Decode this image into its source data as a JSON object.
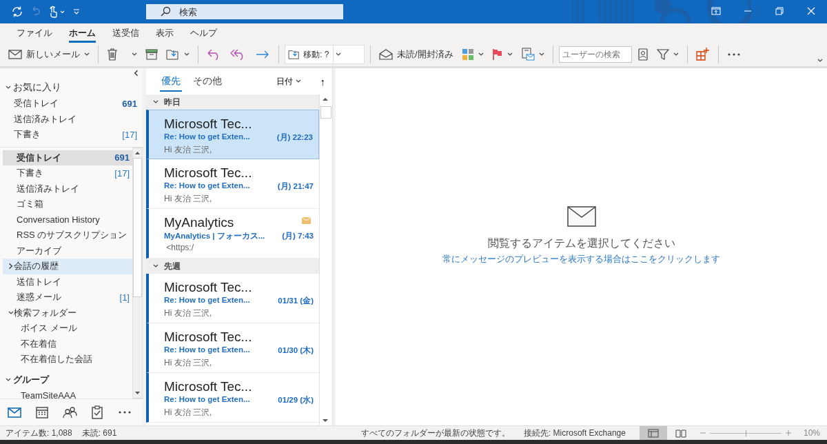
{
  "title_bar": {
    "search_placeholder": "検索"
  },
  "ribbon_tabs": [
    {
      "label": "ファイル",
      "selected": false
    },
    {
      "label": "ホーム",
      "selected": true
    },
    {
      "label": "送受信",
      "selected": false
    },
    {
      "label": "表示",
      "selected": false
    },
    {
      "label": "ヘルプ",
      "selected": false
    }
  ],
  "toolbar": {
    "new_mail": "新しいメール",
    "move_label": "移動: ?",
    "read_unread": "未読/開封済み",
    "people_search_placeholder": "ユーザーの検索"
  },
  "folder_pane": {
    "favorites": {
      "title": "お気に入り",
      "expanded": true,
      "items": [
        {
          "name": "受信トレイ",
          "count": "691",
          "kind": "unread"
        },
        {
          "name": "送信済みトレイ"
        },
        {
          "name": "下書き",
          "count": "[17]",
          "kind": "bracket"
        }
      ]
    },
    "mailbox": [
      {
        "name": "受信トレイ",
        "count": "691",
        "kind": "unread",
        "selected": true,
        "hovered": false
      },
      {
        "name": "下書き",
        "count": "[17]",
        "kind": "bracket",
        "selected": false,
        "hovered": false
      },
      {
        "name": "送信済みトレイ",
        "selected": false,
        "hovered": false
      },
      {
        "name": "ゴミ箱",
        "selected": false,
        "hovered": false
      },
      {
        "name": "Conversation History",
        "selected": false,
        "hovered": false
      },
      {
        "name": "RSS のサブスクリプション",
        "selected": false,
        "hovered": false
      },
      {
        "name": "アーカイブ",
        "selected": false,
        "hovered": false
      },
      {
        "name": "会話の履歴",
        "selected": false,
        "hovered": true,
        "expanded": false
      },
      {
        "name": "送信トレイ",
        "selected": false,
        "hovered": false
      },
      {
        "name": "迷惑メール",
        "count": "[1]",
        "kind": "bracket",
        "selected": false,
        "hovered": false
      },
      {
        "name": "検索フォルダー",
        "selected": false,
        "hovered": false,
        "expanded": true,
        "children": [
          {
            "name": "ボイス メール",
            "selected": false,
            "hovered": false
          },
          {
            "name": "不在着信",
            "selected": false,
            "hovered": false
          },
          {
            "name": "不在着信した会話",
            "selected": false,
            "hovered": false
          }
        ]
      }
    ],
    "groups": {
      "title": "グループ",
      "expanded": true,
      "items": [
        {
          "name": "TeamSiteAAA"
        }
      ]
    }
  },
  "nav_bar": [
    {
      "kind": "mail",
      "selected": true
    },
    {
      "kind": "calendar",
      "selected": false
    },
    {
      "kind": "people",
      "selected": false
    },
    {
      "kind": "tasks",
      "selected": false
    },
    {
      "kind": "more",
      "selected": false
    }
  ],
  "mail_list": {
    "tabs": [
      {
        "label": "優先",
        "selected": true
      },
      {
        "label": "その他",
        "selected": false
      }
    ],
    "sort_label": "日付",
    "sort_direction": "↑",
    "groups": [
      {
        "label": "昨日",
        "expanded": true,
        "messages": [
          {
            "sender": "Microsoft Tec...",
            "subject": "Re: How to get Exten...",
            "time": "(月) 22:23",
            "preview": "Hi 友治 三沢,",
            "selected": true,
            "unread": true,
            "envelope": false
          },
          {
            "sender": "Microsoft Tec...",
            "subject": "Re: How to get Exten...",
            "time": "(月) 21:47",
            "preview": "Hi 友治 三沢,",
            "selected": false,
            "unread": true,
            "envelope": false
          },
          {
            "sender": "MyAnalytics",
            "subject": "MyAnalytics | フォーカス...",
            "time": "(月) 7:43",
            "preview": " <https:/",
            "selected": false,
            "unread": true,
            "envelope": true
          }
        ]
      },
      {
        "label": "先週",
        "expanded": true,
        "messages": [
          {
            "sender": "Microsoft Tec...",
            "subject": "Re: How to get Exten...",
            "time": "01/31 (金)",
            "preview": "Hi 友治 三沢,",
            "selected": false,
            "unread": true,
            "envelope": false
          },
          {
            "sender": "Microsoft Tec...",
            "subject": "Re: How to get Exten...",
            "time": "01/30 (木)",
            "preview": "Hi 友治 三沢,",
            "selected": false,
            "unread": true,
            "envelope": false
          },
          {
            "sender": "Microsoft Tec...",
            "subject": "Re: How to get Exten...",
            "time": "01/29 (水)",
            "preview": "Hi 友治 三沢,",
            "selected": false,
            "unread": true,
            "envelope": false
          }
        ]
      }
    ]
  },
  "reading_pane": {
    "title": "閲覧するアイテムを選択してください",
    "link": "常にメッセージのプレビューを表示する場合はここをクリックします"
  },
  "status_bar": {
    "item_count": "アイテム数: 1,088",
    "unread_count": "未読: 691",
    "sync_status": "すべてのフォルダーが最新の状態です。",
    "connection": "接続先: Microsoft Exchange",
    "views": [
      {
        "kind": "normal",
        "selected": true
      },
      {
        "kind": "reading",
        "selected": false
      }
    ],
    "zoom": {
      "level": 0.5,
      "reading": "10%"
    }
  }
}
